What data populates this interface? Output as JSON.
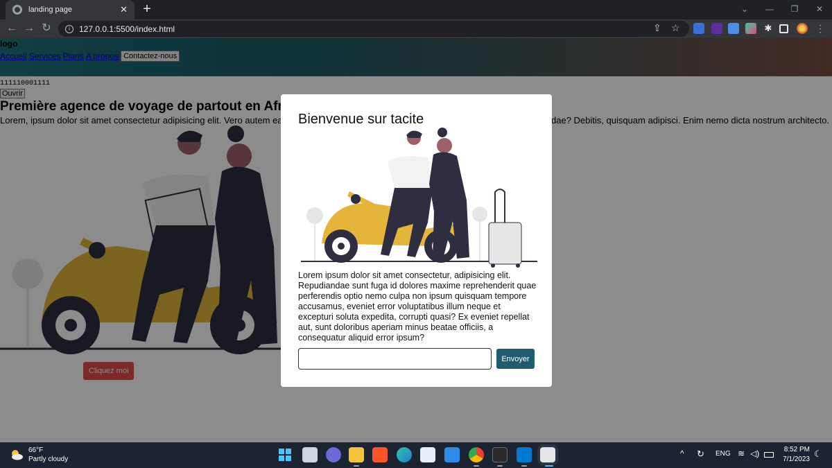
{
  "browser": {
    "tab_title": "landing page",
    "tab_close": "✕",
    "new_tab": "+",
    "url": "127.0.0.1:5500/index.html",
    "window_controls": [
      "⌄",
      "—",
      "❐",
      "✕"
    ]
  },
  "site": {
    "logo": "logo",
    "nav_links": [
      "Accueil",
      "Services",
      "Plans",
      "A propos"
    ],
    "contact_button": "Contactez-nous",
    "digits": "111110001111",
    "open_button": "Ouvrir",
    "hero_title": "Première agence de voyage de partout en Afrique",
    "hero_text_left": "Lorem, ipsum dolor sit amet consectetur adipisicing elit. Vero autem earum",
    "hero_text_right": "dae? Debitis, quisquam adipisci. Enim nemo dicta nostrum architecto.",
    "cta_button": "Cliquez moi"
  },
  "modal": {
    "title": "Bienvenue sur tacite",
    "text": "Lorem ipsum dolor sit amet consectetur, adipisicing elit. Repudiandae sunt fuga id dolores maxime reprehenderit quae perferendis optio nemo culpa non ipsum quisquam tempore accusamus, eveniet error voluptatibus illum neque et excepturi soluta expedita, corrupti quasi? Ex eveniet repellat aut, sunt doloribus aperiam minus beatae officiis, a consequatur aliquid error ipsum?",
    "input_value": "",
    "submit_button": "Envoyer"
  },
  "taskbar": {
    "temperature": "66°F",
    "condition": "Partly cloudy",
    "language": "ENG",
    "time": "8:52 PM",
    "date": "7/1/2023"
  },
  "colors": {
    "scooter_yellow": "#e4b43b",
    "cta_red": "#e04b4b",
    "modal_button": "#1f5c6d",
    "header_teal": "#20727c"
  },
  "icons": [
    "back-icon",
    "forward-icon",
    "reload-icon",
    "info-icon",
    "share-icon",
    "star-icon",
    "extensions-icon",
    "profile-icon",
    "weather-icon",
    "windows-start-icon",
    "wifi-icon",
    "volume-icon",
    "battery-icon"
  ]
}
